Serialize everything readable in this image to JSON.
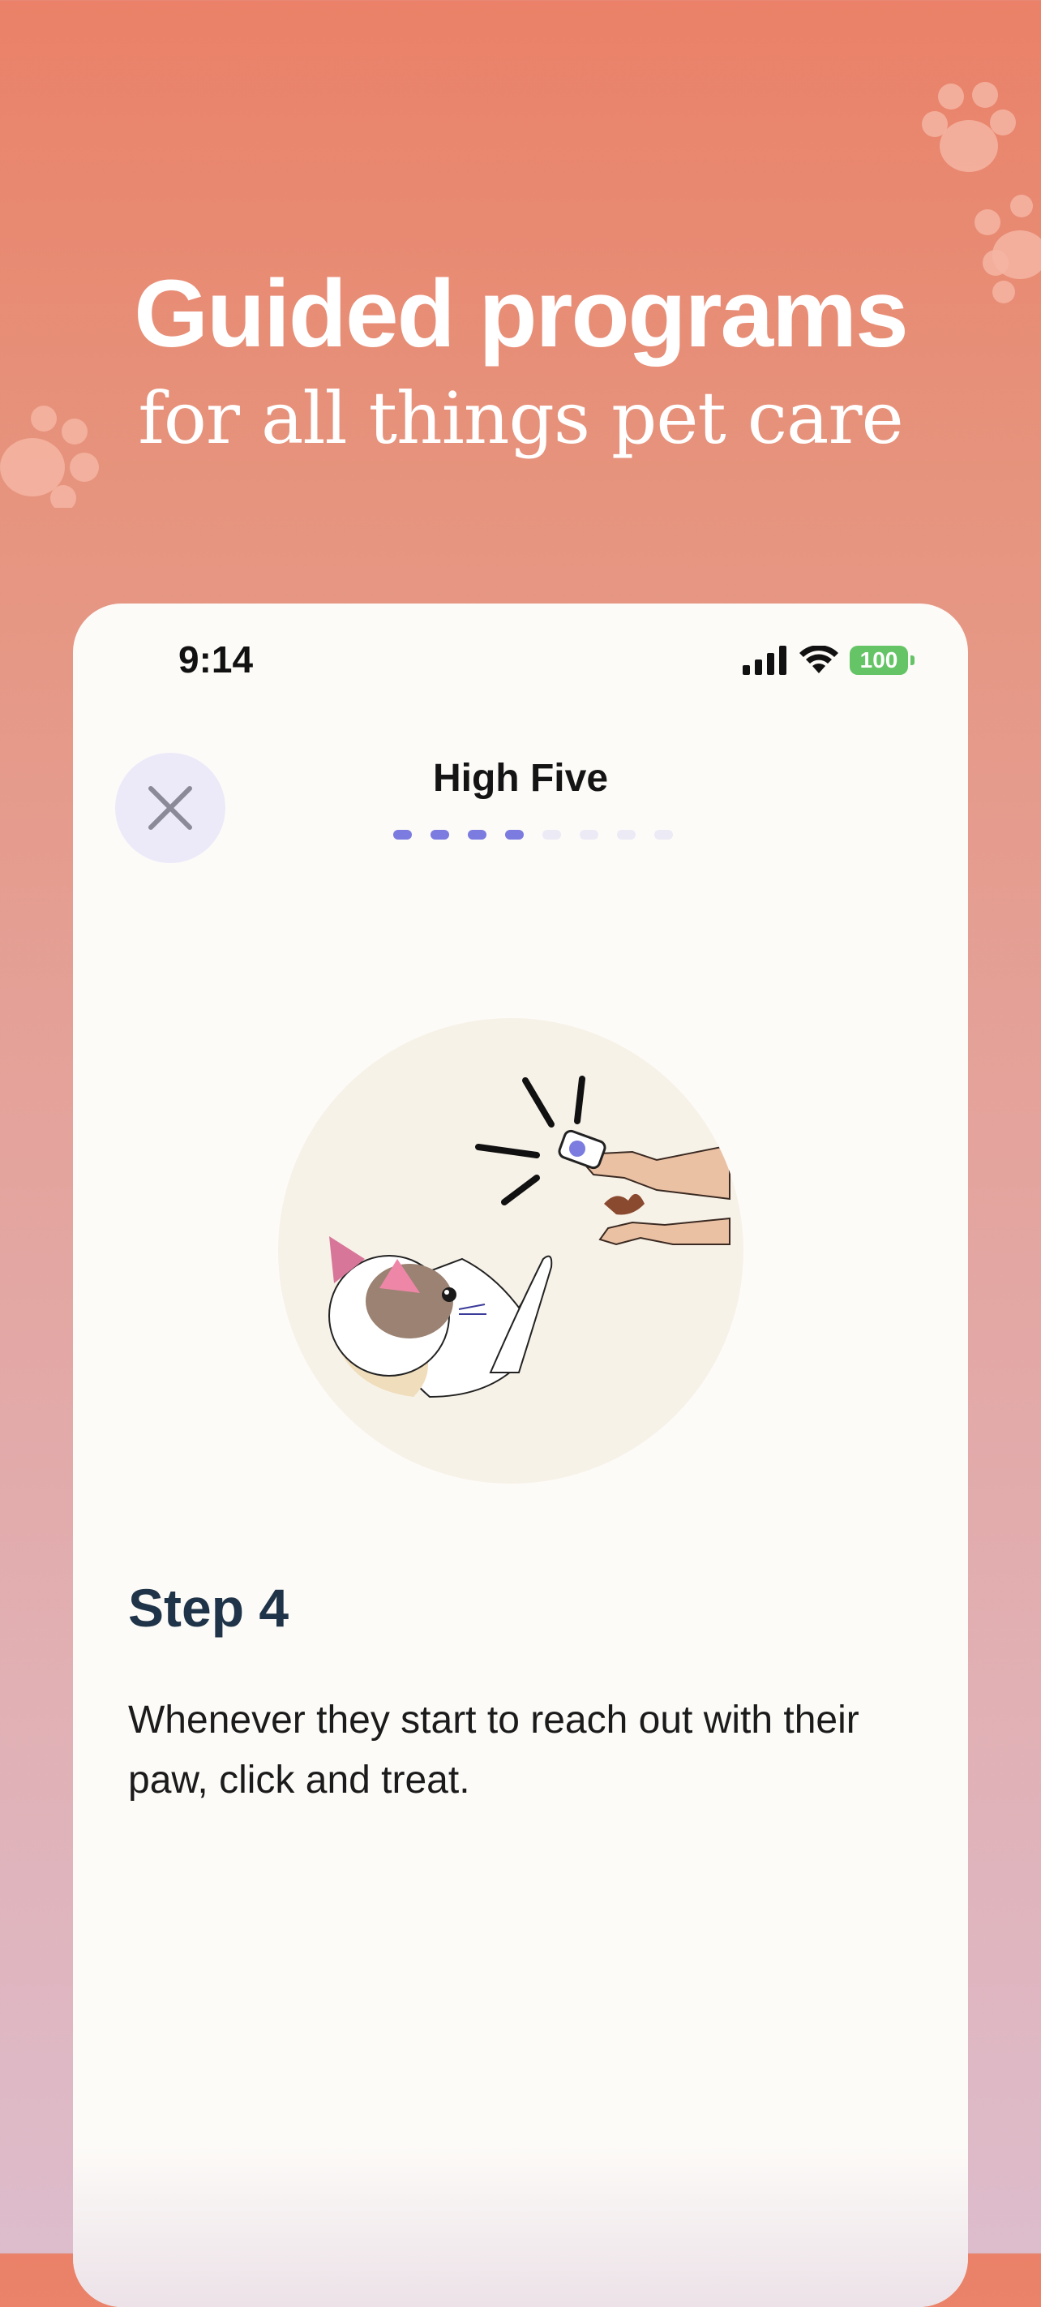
{
  "hero": {
    "title": "Guided programs",
    "subtitle": "for all things pet care"
  },
  "status_bar": {
    "time": "9:14",
    "battery": "100",
    "icons": [
      "signal-icon",
      "wifi-icon",
      "battery-icon"
    ]
  },
  "lesson": {
    "title": "High Five",
    "progress": {
      "total_steps": 8,
      "completed_steps": 4
    },
    "close_icon": "close-icon"
  },
  "step": {
    "heading": "Step 4",
    "body": "Whenever they start to reach out with their paw, click and treat."
  },
  "colors": {
    "accent": "#7B7BE0",
    "heading": "#1F3448",
    "card_bg": "#FDFBF8",
    "illustration_bg": "#F7F2E8"
  }
}
